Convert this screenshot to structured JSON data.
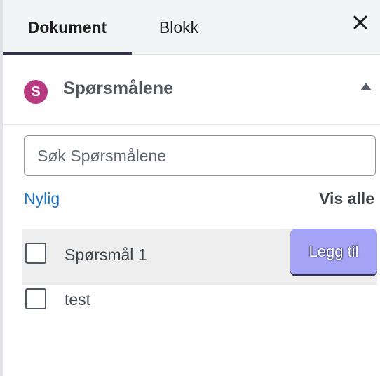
{
  "tabs": [
    {
      "label": "Dokument",
      "active": true
    },
    {
      "label": "Blokk",
      "active": false
    }
  ],
  "close_icon": "close-icon",
  "section": {
    "avatar_letter": "S",
    "avatar_color": "#b83b82",
    "title": "Spørsmålene",
    "expanded": true
  },
  "search": {
    "placeholder": "Søk Spørsmålene",
    "value": ""
  },
  "links": {
    "recent": "Nylig",
    "all": "Vis alle"
  },
  "items": [
    {
      "label": "Spørsmål 1",
      "checked": false,
      "highlighted": true,
      "action": "Legg til"
    },
    {
      "label": "test",
      "checked": false,
      "highlighted": false
    }
  ],
  "colors": {
    "accent": "#32334b",
    "link": "#1e73be",
    "add_button": "#a4a3f6"
  }
}
